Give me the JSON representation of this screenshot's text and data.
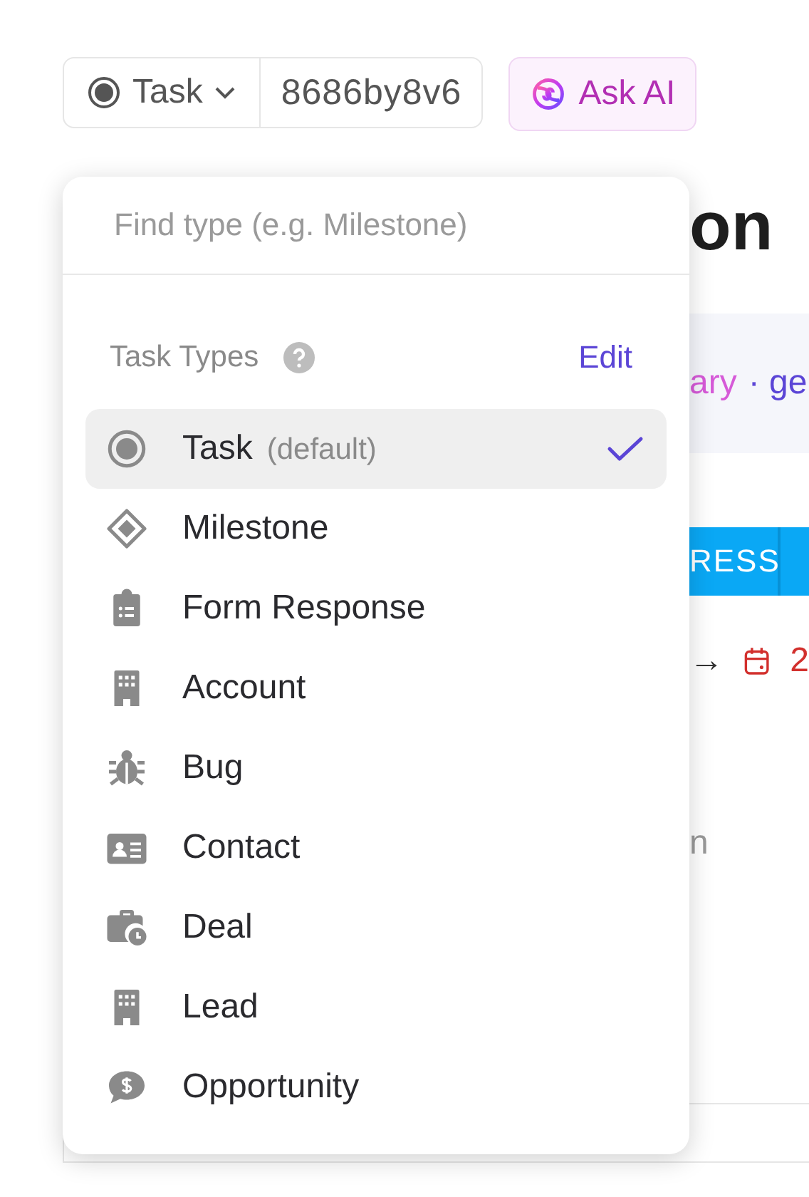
{
  "header": {
    "type_button": {
      "label": "Task"
    },
    "task_id": "8686by8v6",
    "ask_ai": {
      "label": "Ask AI"
    }
  },
  "background": {
    "title": "on",
    "tags": [
      {
        "text": "ary",
        "color": "#d65ad8"
      },
      {
        "text": "· ge",
        "color": "#5b45d6"
      }
    ],
    "status": "RESS",
    "arrow": "→",
    "due": "2",
    "fragment": "n"
  },
  "type_menu": {
    "search": {
      "placeholder": "Find type (e.g. Milestone)"
    },
    "section_title": "Task Types",
    "edit_link": "Edit",
    "items": [
      {
        "kind": "task",
        "label": "Task",
        "note": "(default)",
        "selected": true
      },
      {
        "kind": "milestone",
        "label": "Milestone",
        "selected": false
      },
      {
        "kind": "form",
        "label": "Form Response",
        "selected": false
      },
      {
        "kind": "building",
        "label": "Account",
        "selected": false
      },
      {
        "kind": "bug",
        "label": "Bug",
        "selected": false
      },
      {
        "kind": "contact",
        "label": "Contact",
        "selected": false
      },
      {
        "kind": "deal",
        "label": "Deal",
        "selected": false
      },
      {
        "kind": "building",
        "label": "Lead",
        "selected": false
      },
      {
        "kind": "opportunity",
        "label": "Opportunity",
        "selected": false
      }
    ]
  }
}
